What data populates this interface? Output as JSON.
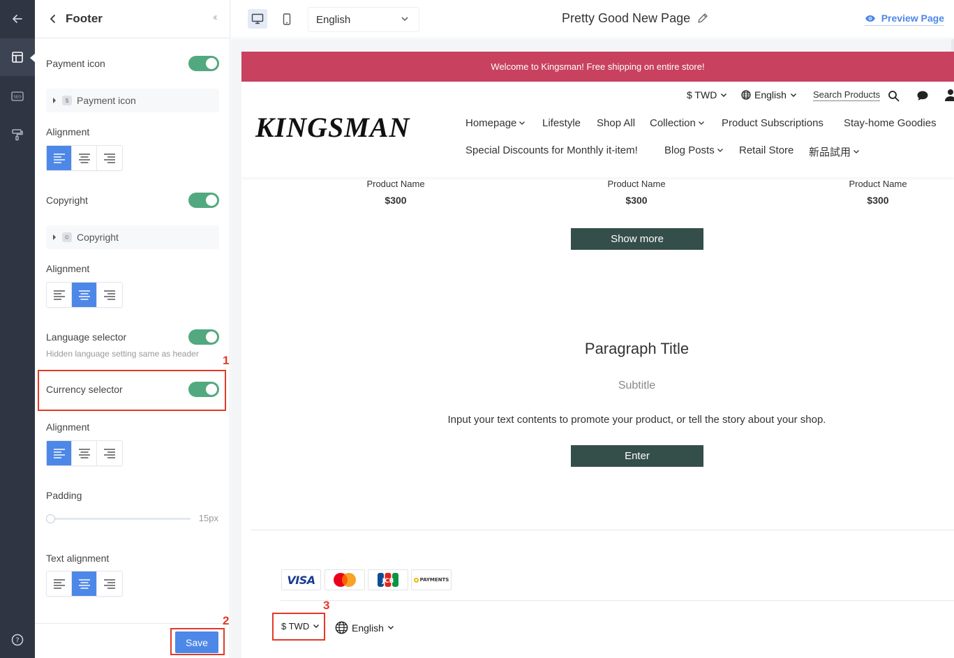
{
  "panel": {
    "title": "Footer",
    "payment_icon": {
      "label": "Payment icon",
      "subitem": "Payment icon"
    },
    "alignment_label": "Alignment",
    "copyright": {
      "label": "Copyright",
      "subitem": "Copyright"
    },
    "language_selector": {
      "label": "Language selector",
      "hint": "Hidden language setting same as header"
    },
    "currency_selector": {
      "label": "Currency selector"
    },
    "padding": {
      "label": "Padding",
      "value": "15px",
      "level": 0.0
    },
    "text_alignment_label": "Text alignment",
    "save_label": "Save"
  },
  "markers": {
    "one": "1",
    "two": "2",
    "three": "3"
  },
  "toolbar": {
    "language": "English",
    "page_title": "Pretty Good New Page",
    "preview_label": "Preview Page"
  },
  "store": {
    "announcement": "Welcome to Kingsman! Free shipping on entire store!",
    "currency": "$ TWD",
    "language": "English",
    "search_placeholder": "Search Products",
    "logo": "KINGSMAN",
    "nav": {
      "homepage": "Homepage",
      "lifestyle": "Lifestyle",
      "shop_all": "Shop All",
      "collection": "Collection",
      "subscriptions": "Product Subscriptions",
      "stay_home": "Stay-home Goodies",
      "discounts": "Special Discounts for Monthly it-item!",
      "blog": "Blog Posts",
      "retail": "Retail Store",
      "new_trial": "新品試用"
    },
    "products": [
      {
        "name": "Product Name",
        "price": "$300"
      },
      {
        "name": "Product Name",
        "price": "$300"
      },
      {
        "name": "Product Name",
        "price": "$300"
      }
    ],
    "show_more": "Show more",
    "paragraph": {
      "title": "Paragraph Title",
      "subtitle": "Subtitle",
      "body": "Input your text contents to promote your product, or tell the story about your shop.",
      "button": "Enter"
    },
    "payments": [
      "VISA",
      "mastercard",
      "JCB",
      "PAYMENTS"
    ],
    "footer_currency": "$ TWD",
    "footer_language": "English"
  },
  "colors": {
    "accent": "#4d87e8",
    "toggle_on": "#52a97f",
    "announcement": "#c8415e",
    "dark_button": "#344e49",
    "annotation": "#e03a26"
  }
}
